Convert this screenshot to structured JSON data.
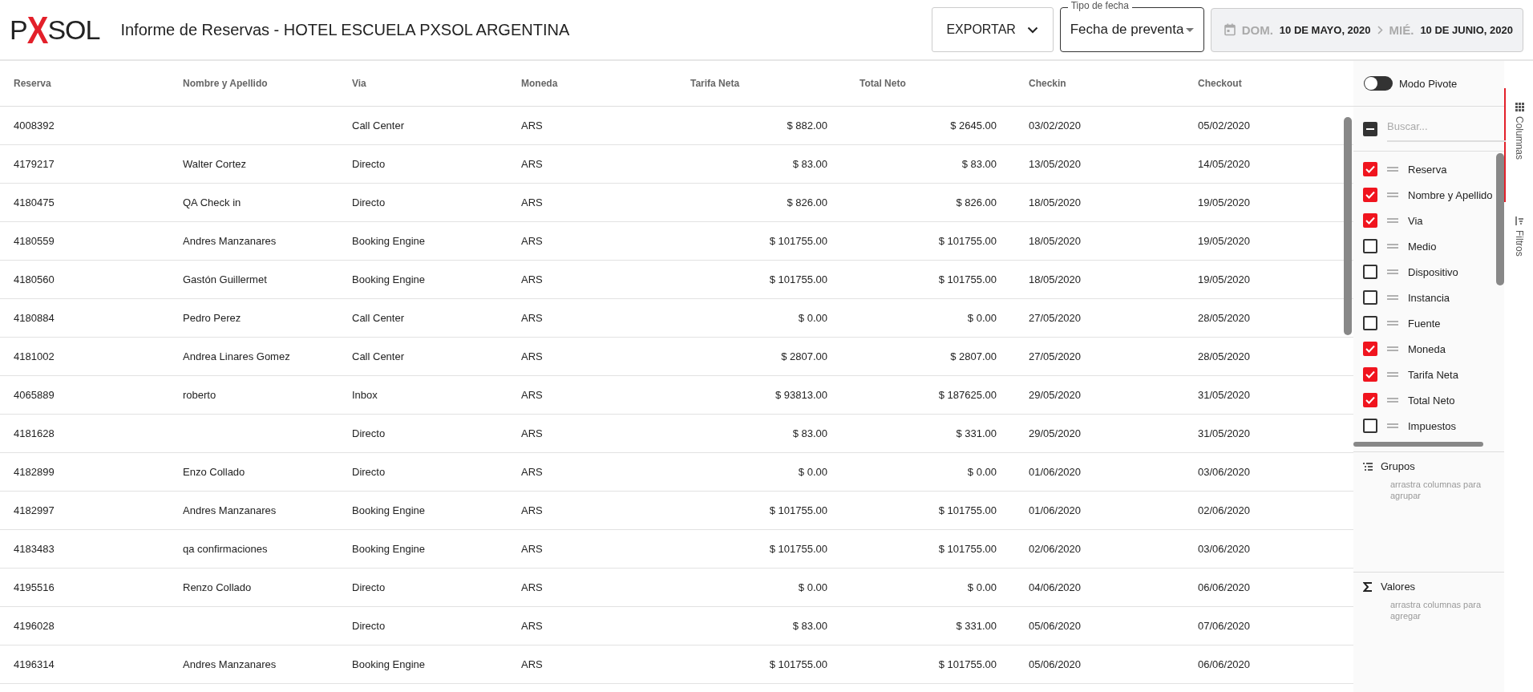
{
  "header": {
    "logo": "PXSOL",
    "title": "Informe de Reservas - HOTEL ESCUELA PXSOL ARGENTINA",
    "export_button": "EXPORTAR",
    "date_type": {
      "label": "Tipo de fecha",
      "value": "Fecha de preventa"
    },
    "date_range": {
      "disabled": true,
      "from_day": "DOM.",
      "from_date": "10 DE MAYO, 2020",
      "to_day": "MIÉ.",
      "to_date": "10 DE JUNIO, 2020"
    }
  },
  "table": {
    "columns": [
      {
        "label": "Reserva",
        "kind": "text"
      },
      {
        "label": "Nombre y Apellido",
        "kind": "text"
      },
      {
        "label": "Via",
        "kind": "text"
      },
      {
        "label": "Moneda",
        "kind": "text"
      },
      {
        "label": "Tarifa Neta",
        "kind": "money"
      },
      {
        "label": "Total Neto",
        "kind": "money"
      },
      {
        "label": "Checkin",
        "kind": "text"
      },
      {
        "label": "Checkout",
        "kind": "text"
      }
    ],
    "rows": [
      [
        "4008392",
        "",
        "Call Center",
        "ARS",
        "$ 882.00",
        "$ 2645.00",
        "03/02/2020",
        "05/02/2020"
      ],
      [
        "4179217",
        "Walter Cortez",
        "Directo",
        "ARS",
        "$ 83.00",
        "$ 83.00",
        "13/05/2020",
        "14/05/2020"
      ],
      [
        "4180475",
        "QA Check in",
        "Directo",
        "ARS",
        "$ 826.00",
        "$ 826.00",
        "18/05/2020",
        "19/05/2020"
      ],
      [
        "4180559",
        "Andres Manzanares",
        "Booking Engine",
        "ARS",
        "$ 101755.00",
        "$ 101755.00",
        "18/05/2020",
        "19/05/2020"
      ],
      [
        "4180560",
        "Gastón Guillermet",
        "Booking Engine",
        "ARS",
        "$ 101755.00",
        "$ 101755.00",
        "18/05/2020",
        "19/05/2020"
      ],
      [
        "4180884",
        "Pedro Perez",
        "Call Center",
        "ARS",
        "$ 0.00",
        "$ 0.00",
        "27/05/2020",
        "28/05/2020"
      ],
      [
        "4181002",
        "Andrea Linares Gomez",
        "Call Center",
        "ARS",
        "$ 2807.00",
        "$ 2807.00",
        "27/05/2020",
        "28/05/2020"
      ],
      [
        "4065889",
        "roberto",
        "Inbox",
        "ARS",
        "$ 93813.00",
        "$ 187625.00",
        "29/05/2020",
        "31/05/2020"
      ],
      [
        "4181628",
        "",
        "Directo",
        "ARS",
        "$ 83.00",
        "$ 331.00",
        "29/05/2020",
        "31/05/2020"
      ],
      [
        "4182899",
        "Enzo Collado",
        "Directo",
        "ARS",
        "$ 0.00",
        "$ 0.00",
        "01/06/2020",
        "03/06/2020"
      ],
      [
        "4182997",
        "Andres Manzanares",
        "Booking Engine",
        "ARS",
        "$ 101755.00",
        "$ 101755.00",
        "01/06/2020",
        "02/06/2020"
      ],
      [
        "4183483",
        "qa confirmaciones",
        "Booking Engine",
        "ARS",
        "$ 101755.00",
        "$ 101755.00",
        "02/06/2020",
        "03/06/2020"
      ],
      [
        "4195516",
        "Renzo Collado",
        "Directo",
        "ARS",
        "$ 0.00",
        "$ 0.00",
        "04/06/2020",
        "06/06/2020"
      ],
      [
        "4196028",
        "",
        "Directo",
        "ARS",
        "$ 83.00",
        "$ 331.00",
        "05/06/2020",
        "07/06/2020"
      ],
      [
        "4196314",
        "Andres Manzanares",
        "Booking Engine",
        "ARS",
        "$ 101755.00",
        "$ 101755.00",
        "05/06/2020",
        "06/06/2020"
      ]
    ]
  },
  "panel": {
    "pivot": {
      "label": "Modo Pivote",
      "on": false
    },
    "search": {
      "placeholder": "Buscar...",
      "indeterminate": true
    },
    "columns": [
      {
        "label": "Reserva",
        "checked": true
      },
      {
        "label": "Nombre y Apellido",
        "checked": true
      },
      {
        "label": "Via",
        "checked": true
      },
      {
        "label": "Medio",
        "checked": false
      },
      {
        "label": "Dispositivo",
        "checked": false
      },
      {
        "label": "Instancia",
        "checked": false
      },
      {
        "label": "Fuente",
        "checked": false
      },
      {
        "label": "Moneda",
        "checked": true
      },
      {
        "label": "Tarifa Neta",
        "checked": true
      },
      {
        "label": "Total Neto",
        "checked": true
      },
      {
        "label": "Impuestos",
        "checked": false
      }
    ],
    "groups": {
      "title": "Grupos",
      "hint": "arrastra columnas para agrupar"
    },
    "values": {
      "title": "Valores",
      "hint": "arrastra columnas para agregar"
    }
  },
  "side_tabs": [
    {
      "label": "Columnas",
      "kind": "columns",
      "selected": true
    },
    {
      "label": "Filtros",
      "kind": "filters",
      "selected": false
    }
  ]
}
